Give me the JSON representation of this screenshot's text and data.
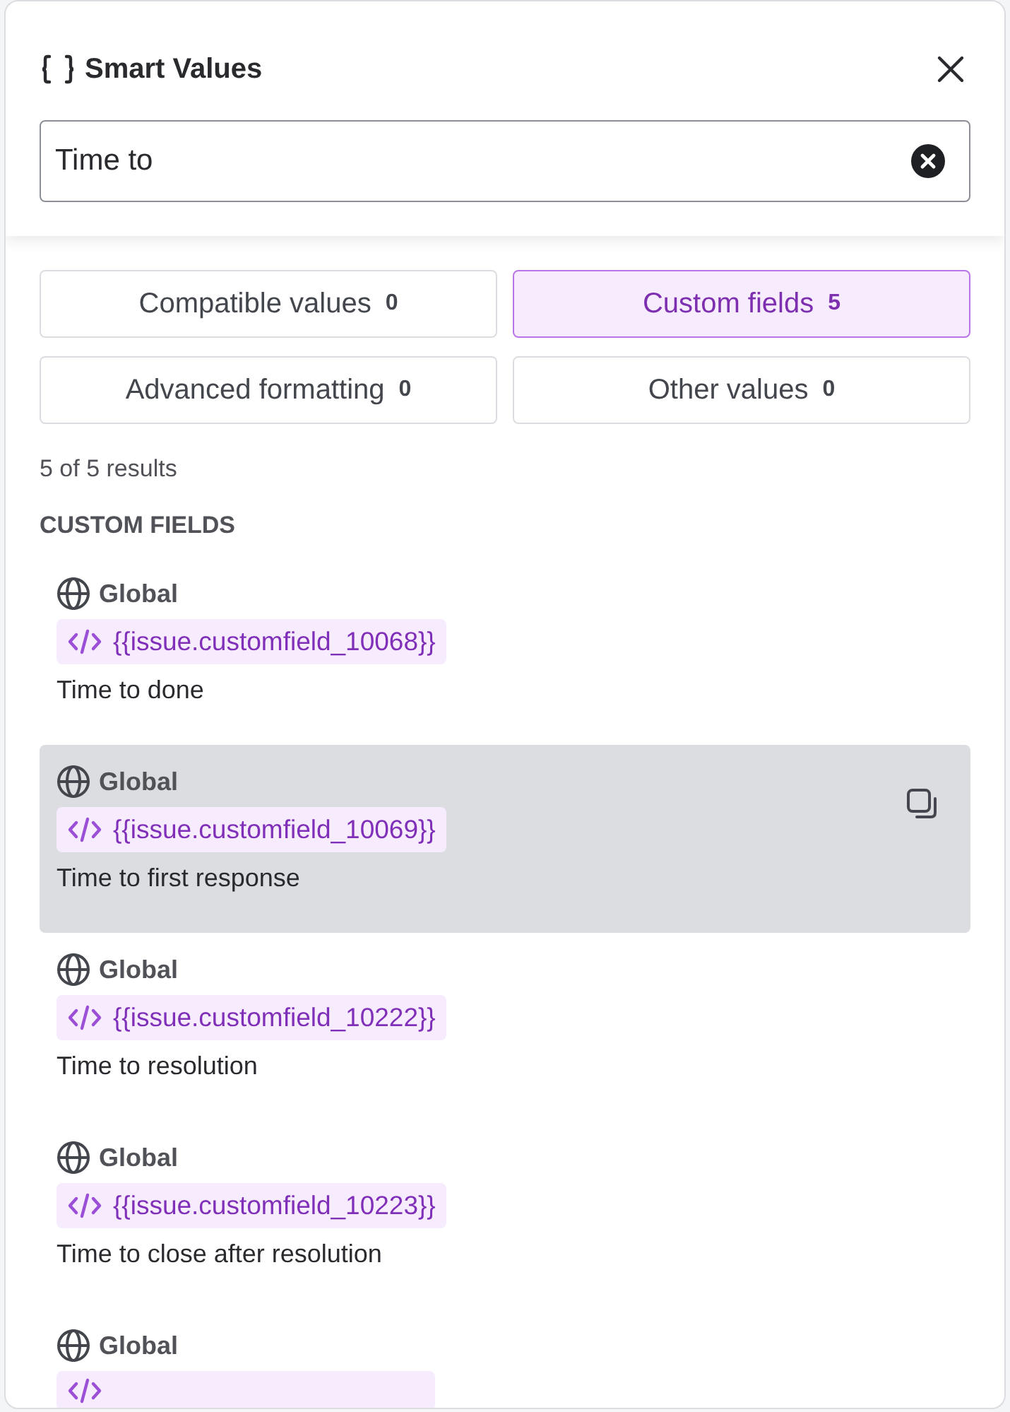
{
  "header": {
    "title": "Smart Values"
  },
  "search": {
    "value": "Time to"
  },
  "tabs": [
    {
      "label": "Compatible values",
      "count": "0",
      "selected": false
    },
    {
      "label": "Custom fields",
      "count": "5",
      "selected": true
    },
    {
      "label": "Advanced formatting",
      "count": "0",
      "selected": false
    },
    {
      "label": "Other values",
      "count": "0",
      "selected": false
    }
  ],
  "results_count": "5 of 5 results",
  "section_heading": "CUSTOM FIELDS",
  "items": [
    {
      "scope": "Global",
      "code": "{{issue.customfield_10068}}",
      "name": "Time to done",
      "selected": false
    },
    {
      "scope": "Global",
      "code": "{{issue.customfield_10069}}",
      "name": "Time to first response",
      "selected": true
    },
    {
      "scope": "Global",
      "code": "{{issue.customfield_10222}}",
      "name": "Time to resolution",
      "selected": false
    },
    {
      "scope": "Global",
      "code": "{{issue.customfield_10223}}",
      "name": "Time to close after resolution",
      "selected": false
    },
    {
      "scope": "Global",
      "selected": false
    }
  ]
}
